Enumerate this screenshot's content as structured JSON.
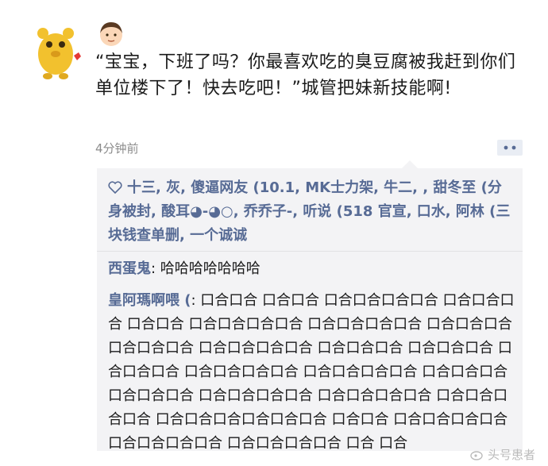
{
  "post": {
    "text": "“宝宝，下班了吗？你最喜欢吃的臭豆腐被我赶到你们单位楼下了！快去吃吧！”城管把妹新技能啊!",
    "timestamp": "4分钟前",
    "emoji_icon": "boy-face-icon",
    "avatar_icon": "yellow-bear-avatar-icon"
  },
  "likes": {
    "text": "十三, 灰, 傻逼网友 (10.1, MK士力架, 牛二, , 甜冬至 (分身被封, 酸耳◕-◕○, 乔乔子-, 听说 (518 官宣, 口水, 阿林 (三块钱查单删, 一个诚诚"
  },
  "comments": [
    {
      "author": "西蛋鬼",
      "text": ": 哈哈哈哈哈哈哈"
    },
    {
      "author": "皇阿瑪啊喂 (",
      "text": ": 口合口合 口合口合 口合口合口合口合 口合口合口合 口合口合 口合口合口合口合 口合口合口合口合 口合口合口合 口合口合口合 口合口合口合口合 口合口合口合 口合口合口合 口合口合口合 口合口合口合口合 口合口合口合口合 口合口合口合口合口合口合 口合口合口合口合 口合口合口合口合 口合口合口合口合 口合口合口合口合口合口合 口合口合 口合口合口合口合 口合口合口合口合 口合口合口合口合 口合 口合"
    }
  ],
  "watermark": {
    "text": "头号患者"
  },
  "colors": {
    "link": "#576b95",
    "comment_bg": "#f3f3f5",
    "timestamp": "#8c8c8c"
  }
}
